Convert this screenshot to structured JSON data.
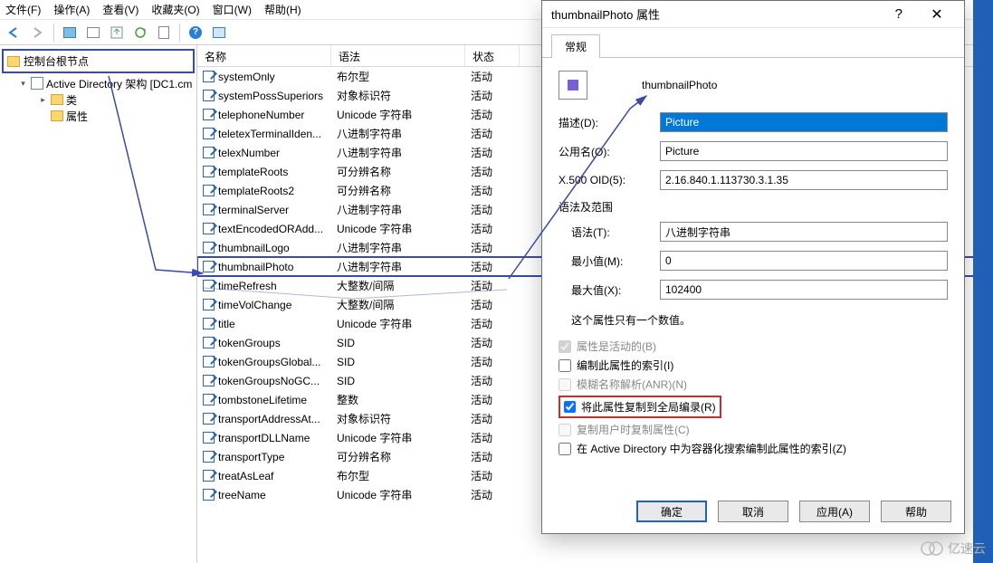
{
  "menu": {
    "file": "文件(F)",
    "action": "操作(A)",
    "view": "查看(V)",
    "fav": "收藏夹(O)",
    "window": "窗口(W)",
    "help": "帮助(H)"
  },
  "tree": {
    "root": "控制台根节点",
    "ad": "Active Directory 架构 [DC1.cm",
    "classes": "类",
    "attrs": "属性"
  },
  "cols": {
    "name": "名称",
    "syntax": "语法",
    "status": "状态"
  },
  "rows": [
    {
      "n": "systemOnly",
      "s": "布尔型",
      "st": "活动"
    },
    {
      "n": "systemPossSuperiors",
      "s": "对象标识符",
      "st": "活动"
    },
    {
      "n": "telephoneNumber",
      "s": "Unicode 字符串",
      "st": "活动"
    },
    {
      "n": "teletexTerminalIden...",
      "s": "八进制字符串",
      "st": "活动"
    },
    {
      "n": "telexNumber",
      "s": "八进制字符串",
      "st": "活动"
    },
    {
      "n": "templateRoots",
      "s": "可分辨名称",
      "st": "活动"
    },
    {
      "n": "templateRoots2",
      "s": "可分辨名称",
      "st": "活动"
    },
    {
      "n": "terminalServer",
      "s": "八进制字符串",
      "st": "活动"
    },
    {
      "n": "textEncodedORAdd...",
      "s": "Unicode 字符串",
      "st": "活动"
    },
    {
      "n": "thumbnailLogo",
      "s": "八进制字符串",
      "st": "活动"
    },
    {
      "n": "thumbnailPhoto",
      "s": "八进制字符串",
      "st": "活动",
      "sel": true
    },
    {
      "n": "timeRefresh",
      "s": "大整数/间隔",
      "st": "活动"
    },
    {
      "n": "timeVolChange",
      "s": "大整数/间隔",
      "st": "活动"
    },
    {
      "n": "title",
      "s": "Unicode 字符串",
      "st": "活动"
    },
    {
      "n": "tokenGroups",
      "s": "SID",
      "st": "活动"
    },
    {
      "n": "tokenGroupsGlobal...",
      "s": "SID",
      "st": "活动"
    },
    {
      "n": "tokenGroupsNoGC...",
      "s": "SID",
      "st": "活动"
    },
    {
      "n": "tombstoneLifetime",
      "s": "整数",
      "st": "活动"
    },
    {
      "n": "transportAddressAt...",
      "s": "对象标识符",
      "st": "活动"
    },
    {
      "n": "transportDLLName",
      "s": "Unicode 字符串",
      "st": "活动"
    },
    {
      "n": "transportType",
      "s": "可分辨名称",
      "st": "活动"
    },
    {
      "n": "treatAsLeaf",
      "s": "布尔型",
      "st": "活动"
    },
    {
      "n": "treeName",
      "s": "Unicode 字符串",
      "st": "活动"
    }
  ],
  "dialog": {
    "title": "thumbnailPhoto 属性",
    "tab": "常规",
    "name": "thumbnailPhoto",
    "labels": {
      "desc": "描述(D):",
      "common": "公用名(O):",
      "oid": "X.500 OID(5):",
      "syntaxrange": "语法及范围",
      "syntax": "语法(T):",
      "min": "最小值(M):",
      "max": "最大值(X):",
      "single": "这个属性只有一个数值。"
    },
    "values": {
      "desc": "Picture",
      "common": "Picture",
      "oid": "2.16.840.1.113730.3.1.35",
      "syntax": "八进制字符串",
      "min": "0",
      "max": "102400"
    },
    "checks": {
      "active": "属性是活动的(B)",
      "index": "编制此属性的索引(I)",
      "anr": "模糊名称解析(ANR)(N)",
      "replicate": "将此属性复制到全局编录(R)",
      "copyuser": "复制用户时复制属性(C)",
      "container": "在 Active Directory 中为容器化搜索编制此属性的索引(Z)"
    },
    "buttons": {
      "ok": "确定",
      "cancel": "取消",
      "apply": "应用(A)",
      "help": "帮助"
    }
  },
  "watermark": "亿速云"
}
